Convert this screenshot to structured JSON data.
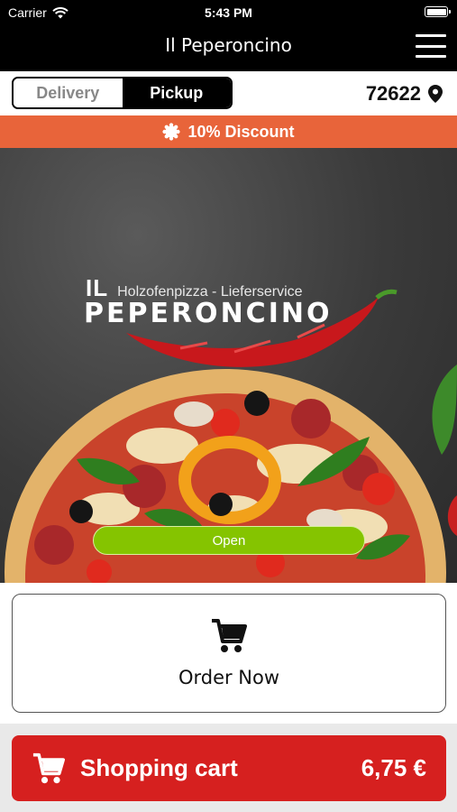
{
  "status_bar": {
    "carrier": "Carrier",
    "time": "5:43 PM"
  },
  "nav": {
    "title": "Il Peperoncino"
  },
  "mode": {
    "delivery_label": "Delivery",
    "pickup_label": "Pickup",
    "selected": "Pickup",
    "zip": "72622"
  },
  "banner": {
    "discount": "10% Discount"
  },
  "hero": {
    "logo_il": "IL",
    "logo_subtitle": "Holzofenpizza - Lieferservice",
    "logo_name": "PEPERONCINO",
    "open_label": "Open"
  },
  "order": {
    "label": "Order Now"
  },
  "cart": {
    "label": "Shopping cart",
    "total": "6,75 €"
  },
  "colors": {
    "banner": "#e8643a",
    "open": "#85c400",
    "cart": "#d6201f"
  }
}
